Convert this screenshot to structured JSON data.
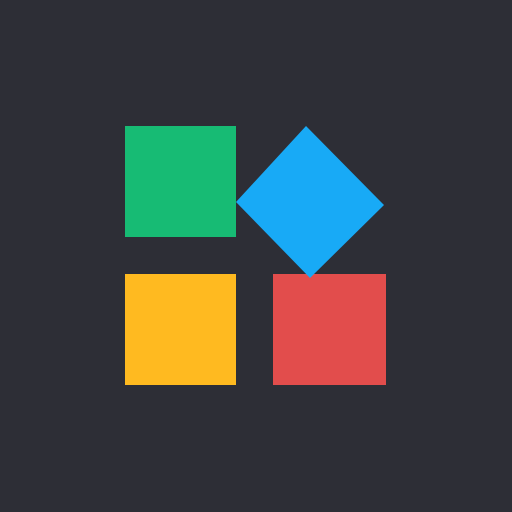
{
  "colors": {
    "background": "#2d2e36",
    "tile_green": "#17bb74",
    "tile_blue": "#18aaf6",
    "tile_yellow": "#ffba20",
    "tile_red": "#e24d4c"
  },
  "icon": {
    "semantic_name": "apps-add-icon",
    "tiles": [
      {
        "name": "green-square",
        "shape": "square",
        "color_key": "tile_green"
      },
      {
        "name": "blue-diamond",
        "shape": "diamond",
        "color_key": "tile_blue"
      },
      {
        "name": "yellow-square",
        "shape": "square",
        "color_key": "tile_yellow"
      },
      {
        "name": "red-square",
        "shape": "square",
        "color_key": "tile_red"
      }
    ]
  }
}
